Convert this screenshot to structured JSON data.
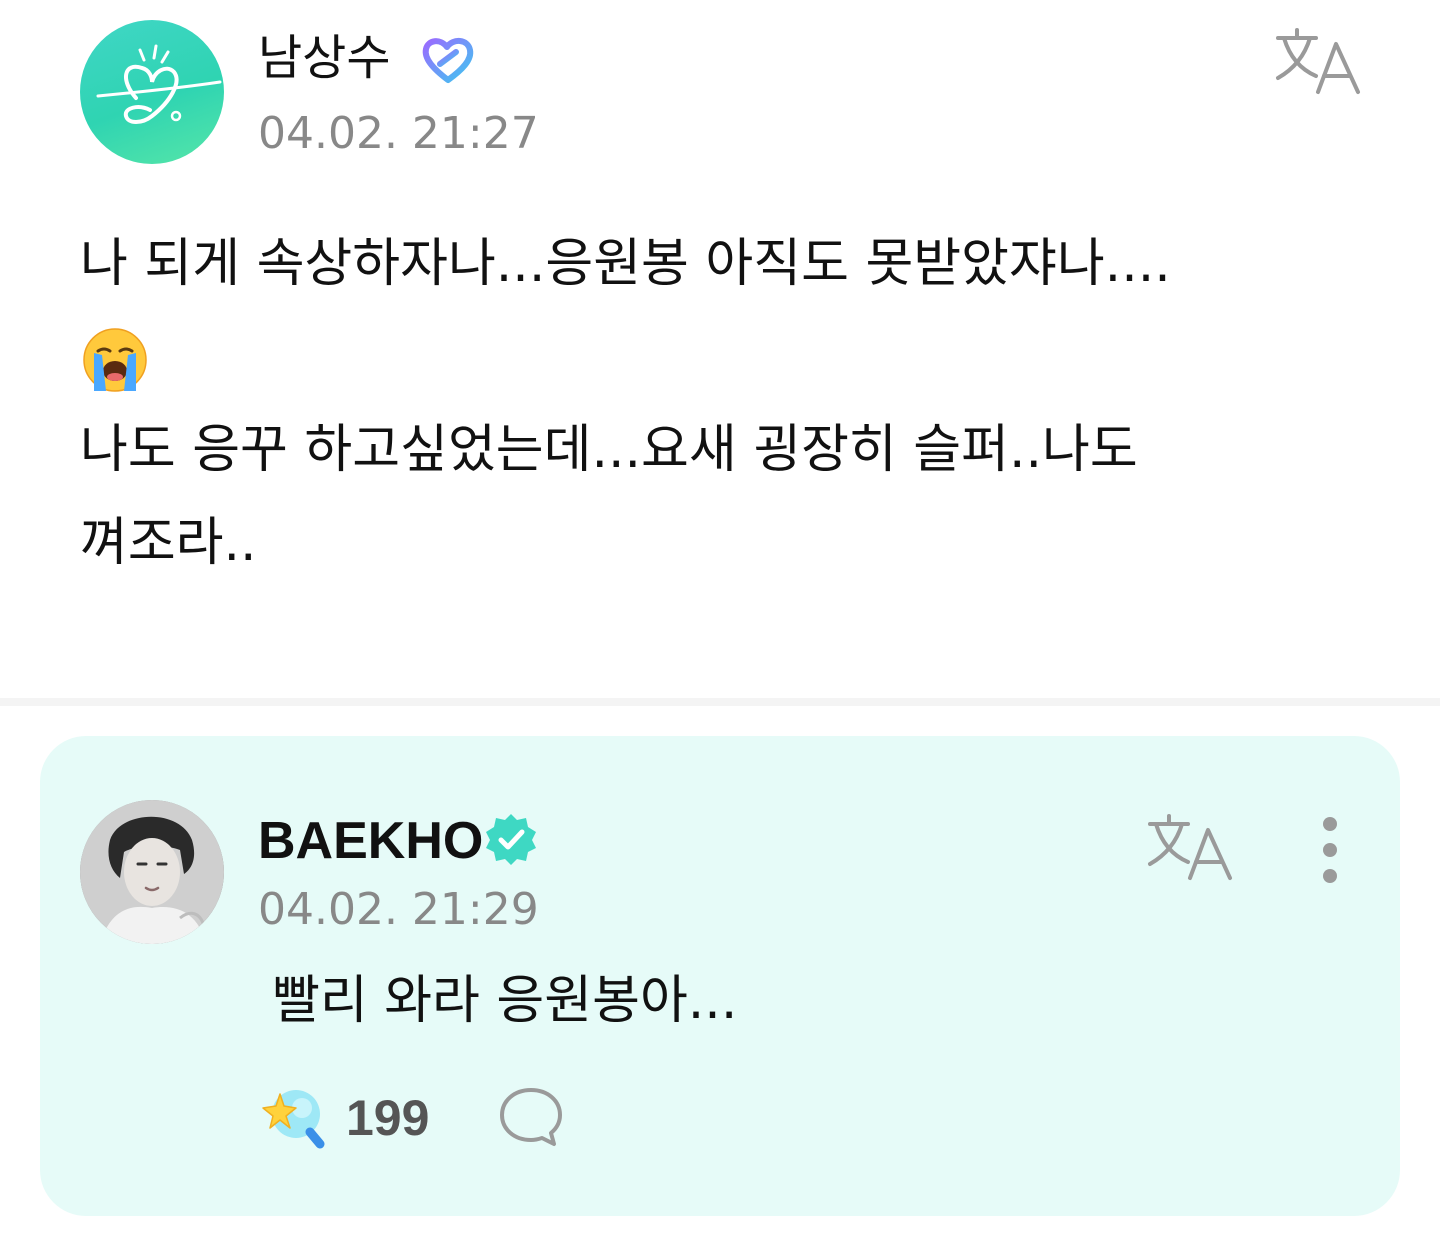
{
  "post": {
    "author_name": "남상수",
    "author_badge_icon": "fan-heart-badge-icon",
    "timestamp": "04.02. 21:27",
    "translate_icon": "translate-icon",
    "body_lines": [
      "나 되게 속상하자나...응원봉 아직도 못받았쟈나....",
      "나도 응꾸 하고싶었는데...요새 굉장히 슬퍼..나도",
      "껴조라.."
    ],
    "emoji": "loudly-crying-face-emoji"
  },
  "reply": {
    "author_name": "BAEKHO",
    "verified_icon": "verified-badge-icon",
    "timestamp": "04.02. 21:29",
    "body": "빨리 와라 응원봉아...",
    "cheer_count": "199",
    "cheer_icon": "cheer-stick-icon",
    "comment_icon": "comment-bubble-icon",
    "more_icon": "more-vertical-icon"
  },
  "colors": {
    "reply_background": "#e6fbf8",
    "accent_mint": "#3ed8c3",
    "timestamp_gray": "#888888"
  }
}
